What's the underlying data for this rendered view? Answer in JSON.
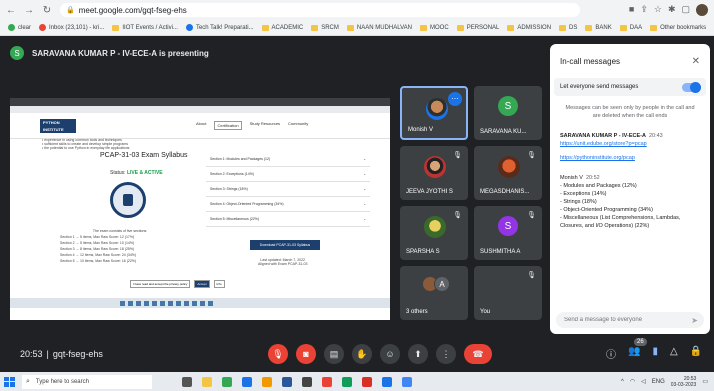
{
  "browser": {
    "url": "meet.google.com/gqt-fseg-ehs",
    "bookmarks": [
      "clear",
      "Inbox (23,101) - kri...",
      "IIOT Events / Activi...",
      "Tech Talk! Preparati...",
      "ACADEMIC",
      "SRCM",
      "NAAN MUDHALVAN",
      "MOOC",
      "PERSONAL",
      "ADMISSION",
      "DS",
      "BANK",
      "DAA",
      "Other bookmarks"
    ]
  },
  "meet": {
    "presenter_initial": "S",
    "presenting_text": "SARAVANA KUMAR P - IV-ECE-A is presenting",
    "meeting_time": "20:53",
    "meeting_code": "gqt-fseg-ehs",
    "separator": "|"
  },
  "shared_screen": {
    "logo_line1": "PYTHON",
    "logo_line2": "INSTITUTE",
    "nav": [
      "About",
      "Certification",
      "Study Resources",
      "Community"
    ],
    "bullets": [
      "• experience in using common tools and techniques",
      "• sufficient skills to create and develop simple programs",
      "• the potential to use Python in everyday life applications"
    ],
    "title": "PCAP-31-03 Exam Syllabus",
    "status_label": "Status:",
    "status_value": "LIVE & ACTIVE",
    "exam_intro": "The exam consists of five sections:",
    "exam_lines": [
      "Section 1 → 5 items, Max Raw Score: 12 (17%)",
      "Section 2 → 5 items, Max Raw Score: 10 (14%)",
      "Section 3 → 8 items, Max Raw Score: 18 (25%)",
      "Section 4 → 12 items, Max Raw Score: 24 (34%)",
      "Section 5 → 10 items, Max Raw Score: 16 (22%)"
    ],
    "sections": [
      "Section 1: Modules and Packages (12)",
      "Section 2: Exceptions (14%)",
      "Section 3: Strings (18%)",
      "Section 4: Object-Oriented Programming (34%)",
      "Section 5: Miscellaneous (22%)"
    ],
    "download_label": "Download PCAP-31-03 Syllabus",
    "last_updated": "Last updated: March 7, 2022",
    "aligned": "Aligned with Exam PCAP-31-03",
    "footer_buttons": [
      "I have read and accept the privacy policy",
      "Accept",
      "Info"
    ]
  },
  "tiles": [
    {
      "name": "Monish V",
      "active": true
    },
    {
      "name": "SARAVANA KU...",
      "initial": "S",
      "color": "#34a853"
    },
    {
      "name": "JEEVA JYOTHI S"
    },
    {
      "name": "MEGASDHANIS..."
    },
    {
      "name": "SPARSHA S"
    },
    {
      "name": "SUSHMITHA A",
      "initial": "S",
      "color": "#9334e6"
    },
    {
      "name": "3 others",
      "initial": "A"
    },
    {
      "name": "You"
    }
  ],
  "panel": {
    "title": "In-call messages",
    "toggle_label": "Let everyone send messages",
    "notice": "Messages can be seen only by people in the call and are deleted when the call ends",
    "messages": [
      {
        "sender": "SARAVANA KUMAR P - IV-ECE-A",
        "time": "20:43",
        "links": [
          "https://unit.edube.org/store?p=pcap",
          "https://pythoninstitute.org/pcap"
        ]
      },
      {
        "sender": "Monish V",
        "time": "20:52",
        "lines": [
          "- Modules and Packages (12%)",
          "- Exceptions (14%)",
          "- Strings (18%)",
          "- Object-Oriented Programming (34%)",
          "- Miscellaneous (List Comprehensions, Lambdas, Closures, and I/O Operations) (22%)"
        ]
      }
    ],
    "input_placeholder": "Send a message to everyone"
  },
  "bottom": {
    "participant_count": "26"
  },
  "taskbar": {
    "search_placeholder": "Type here to search",
    "lang": "ENG",
    "time": "20:53",
    "date": "03-03-2023"
  },
  "colors": {
    "meet_bg": "#202124",
    "tile_bg": "#3c4043",
    "accent": "#1a73e8",
    "leave_red": "#ea4335"
  }
}
